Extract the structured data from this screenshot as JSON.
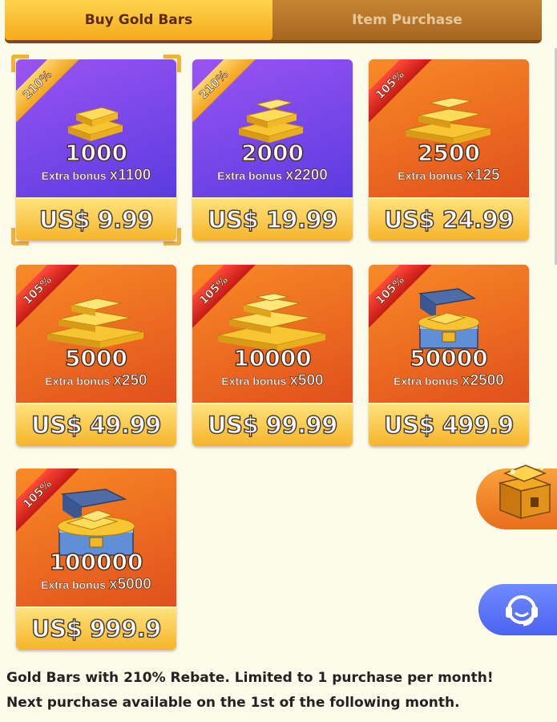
{
  "tabs": [
    {
      "label": "Buy Gold Bars",
      "active": true
    },
    {
      "label": "Item Purchase",
      "active": false
    }
  ],
  "packages": [
    {
      "badge": "210%",
      "badge_color": "gold",
      "theme": "purple",
      "amount": "1000",
      "bonus_label": "Extra bonus",
      "bonus_mult": "x1100",
      "price": "US$ 9.99",
      "selected": true,
      "art": "gold-bars-icon"
    },
    {
      "badge": "210%",
      "badge_color": "gold",
      "theme": "purple",
      "amount": "2000",
      "bonus_label": "Extra bonus",
      "bonus_mult": "x2200",
      "price": "US$ 19.99",
      "selected": false,
      "art": "gold-bars-icon"
    },
    {
      "badge": "105%",
      "badge_color": "red",
      "theme": "orange",
      "amount": "2500",
      "bonus_label": "Extra bonus",
      "bonus_mult": "x125",
      "price": "US$ 24.99",
      "selected": false,
      "art": "gold-bars-icon"
    },
    {
      "badge": "105%",
      "badge_color": "red",
      "theme": "orange",
      "amount": "5000",
      "bonus_label": "Extra bonus",
      "bonus_mult": "x250",
      "price": "US$ 49.99",
      "selected": false,
      "art": "gold-bars-icon"
    },
    {
      "badge": "105%",
      "badge_color": "red",
      "theme": "orange",
      "amount": "10000",
      "bonus_label": "Extra bonus",
      "bonus_mult": "x500",
      "price": "US$ 99.99",
      "selected": false,
      "art": "gold-bars-icon"
    },
    {
      "badge": "105%",
      "badge_color": "red",
      "theme": "orange",
      "amount": "50000",
      "bonus_label": "Extra bonus",
      "bonus_mult": "x2500",
      "price": "US$ 499.9",
      "selected": false,
      "art": "gold-chest-icon"
    },
    {
      "badge": "105%",
      "badge_color": "red",
      "theme": "orange",
      "amount": "100000",
      "bonus_label": "Extra bonus",
      "bonus_mult": "x5000",
      "price": "US$ 999.9",
      "selected": false,
      "art": "gold-chest-icon"
    }
  ],
  "side_buttons": {
    "chest": "treasure-chest-icon",
    "support": "customer-support-icon"
  },
  "footer": {
    "line1": "Gold Bars with 210% Rebate. Limited to 1 purchase per month!",
    "line2": "Next purchase available on the 1st of the following month."
  },
  "colors": {
    "purple_card": "#7a48ea",
    "orange_card": "#ee6a21",
    "price_bar": "#f8c640",
    "tab_active": "#f7b62a",
    "tab_bar": "#7a4a1d",
    "support_button": "#5b75f7"
  }
}
